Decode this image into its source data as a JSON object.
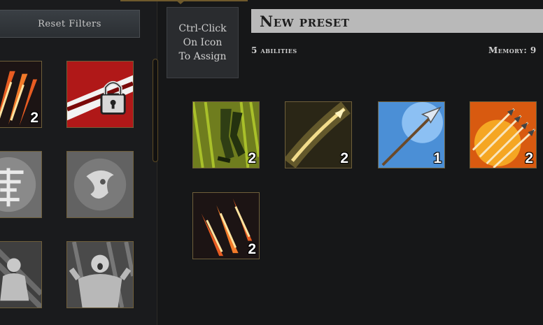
{
  "left": {
    "reset_label": "Reset Filters",
    "grid": [
      {
        "icon": "claw-slash-icon",
        "count": "2"
      },
      {
        "icon": "locked-bleed-icon",
        "count": ""
      },
      {
        "icon": "heal-rune-icon",
        "count": ""
      },
      {
        "icon": "fear-rune-icon",
        "count": ""
      },
      {
        "icon": "ghost-figure-icon",
        "count": ""
      },
      {
        "icon": "rage-figure-icon",
        "count": ""
      }
    ]
  },
  "assign_hint": [
    "Ctrl-Click",
    "On Icon",
    "To Assign"
  ],
  "preset": {
    "name": "New preset",
    "abilities_label": "5 abilities",
    "memory_label": "Memory: 9",
    "abilities": [
      {
        "icon": "sprint-legs-icon",
        "count": "2"
      },
      {
        "icon": "piercing-shot-icon",
        "count": "2"
      },
      {
        "icon": "frost-arrow-icon",
        "count": "1"
      },
      {
        "icon": "fire-volley-icon",
        "count": "2"
      },
      {
        "icon": "claw-slash-icon",
        "count": "2"
      }
    ]
  },
  "colors": {
    "accent": "#6f5a2c",
    "frame": "#6f5f3a",
    "preset_bar": "#b9b9b9"
  }
}
